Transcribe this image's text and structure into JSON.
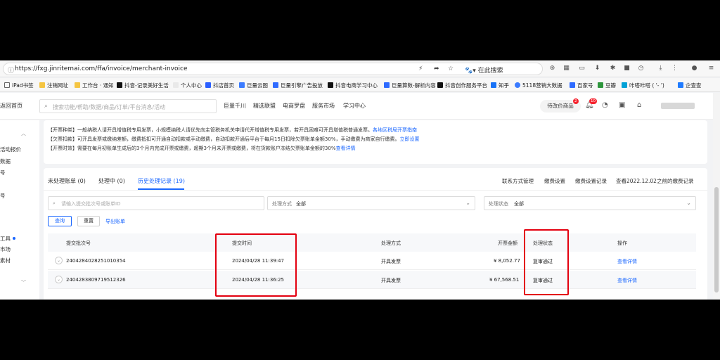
{
  "browser": {
    "url": "https://fxg.jinritemai.com/ffa/invoice/merchant-invoice",
    "search_engine_label": "在此搜索",
    "bookmarks": [
      "iPad书签",
      "注销网址",
      "工作台 · 通知",
      "抖音-记录美好生活",
      "个人中心",
      "抖店首页",
      "巨量云图",
      "巨量引擎广告投放",
      "抖音电商学习中心",
      "巨量算数-解析内容",
      "抖音创作服务平台",
      "知乎",
      "5118营销大数据",
      "百家号",
      "豆瓣",
      "咔嗒咔嗒 ( '- ')",
      "企查查"
    ]
  },
  "header": {
    "back_home": "返回首页",
    "search_placeholder": "搜索功能/帮助/数据/商品/订单/平台消息/活动",
    "nav": [
      "巨量千川",
      "精选联盟",
      "电商罗盘",
      "服务市场",
      "学习中心"
    ],
    "pending_label": "待改价商品",
    "pending_badge": "2",
    "bell_badge": "10"
  },
  "sidebar": {
    "items": [
      "活动报价",
      "数据",
      "号",
      "号",
      "工具",
      "市场",
      "素材"
    ]
  },
  "notice": {
    "line1": "【开票种类】一般纳税人请开具增值税专用发票，小规模纳税人请优先向主管税务机关申请代开增值税专用发票，若开具困难可开具增值税普通发票。",
    "line1_link": "各地区税局开票指南",
    "line2": "【欠票扣款】可开具发票或缴纳差额，缴费抵扣可开通自动扣款或手动缴费，自动扣款开通后平台于每月15日扣除欠票账单金额30%，手动缴费为商家自行缴费。",
    "line2_link": "立即设置",
    "line3": "【开票时效】需要在每月初账单生成后的3个月内完成开票或缴费，超期3个月未开票或缴费，将在货款账户冻结欠票账单金额的30%",
    "line3_link": "查看详情"
  },
  "tabs": [
    {
      "label": "未处理账单 (0)"
    },
    {
      "label": "处理中 (0)"
    },
    {
      "label": "历史处理记录 (19)"
    }
  ],
  "right_links": [
    "联系方式管理",
    "缴费设置",
    "缴费设置记录",
    "查看2022.12.02之前的缴费记录"
  ],
  "filters": {
    "batch_placeholder": "请输入提交批次号或账单ID",
    "method_label": "处理方式",
    "method_value": "全部",
    "status_label": "处理状态",
    "status_value": "全部"
  },
  "buttons": {
    "query": "查询",
    "reset": "重置",
    "export": "导出账单"
  },
  "table": {
    "headers": [
      "提交批次号",
      "提交时间",
      "处理方式",
      "开票金额",
      "处理状态",
      "操作"
    ],
    "rows": [
      {
        "batch": "2404284028251010354",
        "time": "2024/04/28 11:39:47",
        "method": "开具发票",
        "amount": "¥ 8,052.77",
        "status": "复审通过",
        "action": "查看详情"
      },
      {
        "batch": "2404283809719512326",
        "time": "2024/04/28 11:36:25",
        "method": "开具发票",
        "amount": "¥ 67,568.51",
        "status": "复审通过",
        "action": "查看详情"
      }
    ]
  },
  "colors": {
    "accent": "#1966ff",
    "highlight": "#e3000f",
    "badge": "#f5222d"
  }
}
